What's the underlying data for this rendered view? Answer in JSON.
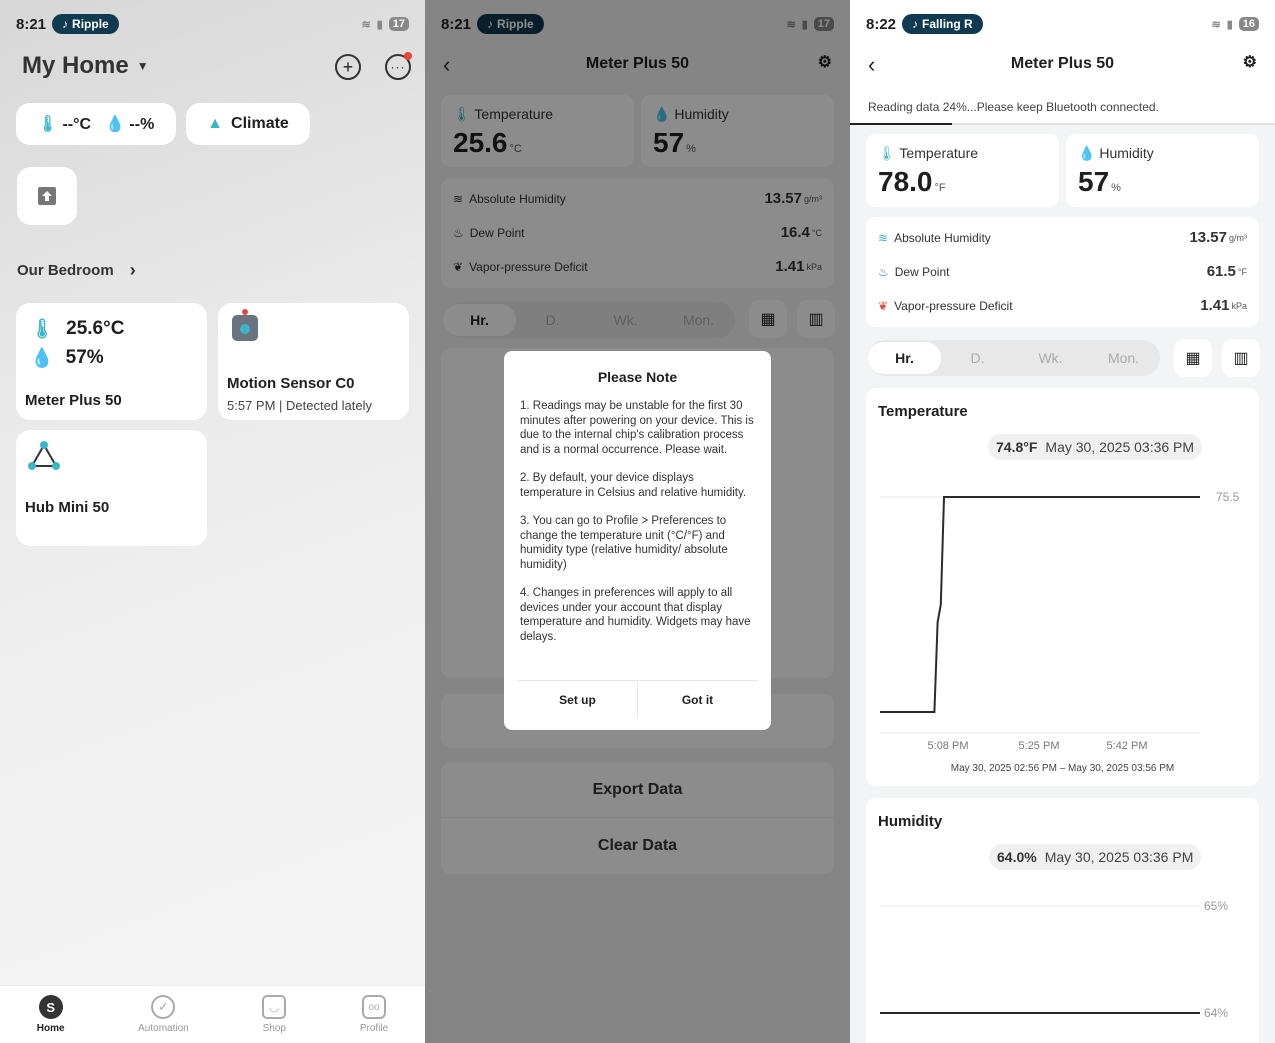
{
  "p1": {
    "status": {
      "time": "8:21",
      "media": "Ripple",
      "battery": "17"
    },
    "title": "My Home",
    "temp_chip": "--°C",
    "hum_chip": "--%",
    "climate": "Climate",
    "room": "Our Bedroom",
    "devices": [
      {
        "temp": "25.6°C",
        "hum": "57%",
        "name": "Meter Plus 50"
      },
      {
        "name": "Motion Sensor C0",
        "status": "5:57 PM | Detected lately"
      },
      {
        "name": "Hub Mini 50"
      }
    ],
    "nav": [
      "Home",
      "Automation",
      "Shop",
      "Profile"
    ],
    "avatar": "S"
  },
  "p2": {
    "status": {
      "time": "8:21",
      "media": "Ripple",
      "battery": "17"
    },
    "title": "Meter Plus 50",
    "temperature_label": "Temperature",
    "temperature_value": "25.6",
    "temperature_unit": "°C",
    "humidity_label": "Humidity",
    "humidity_value": "57",
    "humidity_unit": "%",
    "abs_hum_label": "Absolute Humidity",
    "abs_hum_value": "13.57",
    "abs_hum_unit": "g/m³",
    "dew_label": "Dew Point",
    "dew_value": "16.4",
    "dew_unit": "°C",
    "vpd_label": "Vapor-pressure Deficit",
    "vpd_value": "1.41",
    "vpd_unit": "kPa",
    "tabs": [
      "Hr.",
      "D.",
      "Wk.",
      "Mon."
    ],
    "modal_title": "Please Note",
    "modal_items": [
      "1. Readings may be unstable for the first 30 minutes after powering on your device. This is due to the internal chip's calibration process and is a normal occurrence. Please wait.",
      "2. By default, your device displays temperature in Celsius and relative humidity.",
      "3. You can go to Profile > Preferences to change the temperature unit (°C/°F) and humidity type (relative humidity/ absolute humidity)",
      "4. Changes in preferences will apply to all devices under your account that display temperature and humidity. Widgets may have delays."
    ],
    "btn_setup": "Set up",
    "btn_gotit": "Got it",
    "export": "Export Data",
    "clear": "Clear Data"
  },
  "p3": {
    "status": {
      "time": "8:22",
      "media": "Falling R",
      "battery": "16"
    },
    "title": "Meter Plus 50",
    "reading": "Reading data 24%...Please keep Bluetooth connected.",
    "progress": 0.24,
    "temperature_label": "Temperature",
    "temperature_value": "78.0",
    "temperature_unit": "°F",
    "humidity_label": "Humidity",
    "humidity_value": "57",
    "humidity_unit": "%",
    "abs_hum_label": "Absolute Humidity",
    "abs_hum_value": "13.57",
    "abs_hum_unit": "g/m³",
    "dew_label": "Dew Point",
    "dew_value": "61.5",
    "dew_unit": "°F",
    "vpd_label": "Vapor-pressure Deficit",
    "vpd_value": "1.41",
    "vpd_unit": "kPa",
    "tabs": [
      "Hr.",
      "D.",
      "Wk.",
      "Mon."
    ],
    "temp_chart_title": "Temperature",
    "temp_tip_value": "74.8°F",
    "temp_tip_date": "May 30, 2025 03:36 PM",
    "temp_range": "May 30, 2025 02:56 PM – May 30, 2025 03:56 PM",
    "hum_chart_title": "Humidity",
    "hum_tip_value": "64.0%",
    "hum_tip_date": "May 30, 2025 03:36 PM"
  },
  "chart_data": [
    {
      "type": "line",
      "title": "Temperature",
      "x_ticks": [
        "5:08 PM",
        "5:25 PM",
        "5:42 PM"
      ],
      "y_ticks": [
        "75.5"
      ],
      "series": [
        {
          "x": [
            0,
            0.17,
            0.18,
            0.19,
            0.2,
            1.0
          ],
          "values": [
            74.3,
            74.3,
            74.8,
            74.9,
            75.5,
            75.5
          ]
        }
      ]
    },
    {
      "type": "line",
      "title": "Humidity",
      "y_ticks": [
        "65%",
        "64%"
      ],
      "series": [
        {
          "values": [
            64,
            64
          ]
        }
      ]
    }
  ]
}
